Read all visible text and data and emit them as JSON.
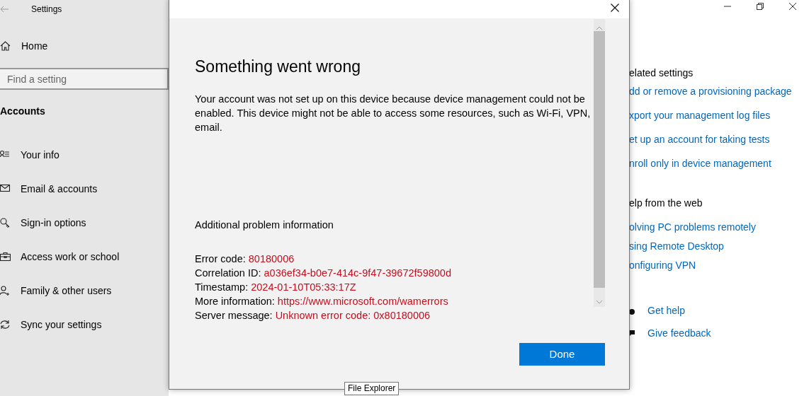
{
  "settings_window": {
    "title": "Settings"
  },
  "sidebar": {
    "home": "Home",
    "search": {
      "placeholder": "Find a setting"
    },
    "section": "Accounts",
    "items": [
      {
        "label": "Your info"
      },
      {
        "label": "Email & accounts"
      },
      {
        "label": "Sign-in options"
      },
      {
        "label": "Access work or school"
      },
      {
        "label": "Family & other users"
      },
      {
        "label": "Sync your settings"
      }
    ]
  },
  "related_settings": {
    "heading": "elated settings",
    "links": [
      "dd or remove a provisioning package",
      "xport your management log files",
      "et up an account for taking tests",
      "nroll only in device management"
    ]
  },
  "help_from_web": {
    "heading": "elp from the web",
    "links": [
      "olving PC problems remotely",
      "sing Remote Desktop",
      "onfiguring VPN"
    ]
  },
  "support_links": [
    "Get help",
    "Give feedback"
  ],
  "dialog": {
    "title": "Something went wrong",
    "message_lines": [
      "Your account was not set up on this device because device management could not be",
      "enabled. This device might not be able to access some resources, such as Wi-Fi, VPN,",
      "email."
    ],
    "details_heading": "Additional problem information",
    "details": [
      {
        "label": "Error code:",
        "value": "80180006"
      },
      {
        "label": "Correlation ID:",
        "value": "a036ef34-b0e7-414c-9f47-39672f59800d"
      },
      {
        "label": "Timestamp:",
        "value": "2024-01-10T05:33:17Z"
      },
      {
        "label": "More information:",
        "value": "https://www.microsoft.com/wamerrors"
      },
      {
        "label": "Server message:",
        "value": "Unknown error code: 0x80180006"
      }
    ],
    "button": "Done"
  },
  "tooltip": "File Explorer"
}
